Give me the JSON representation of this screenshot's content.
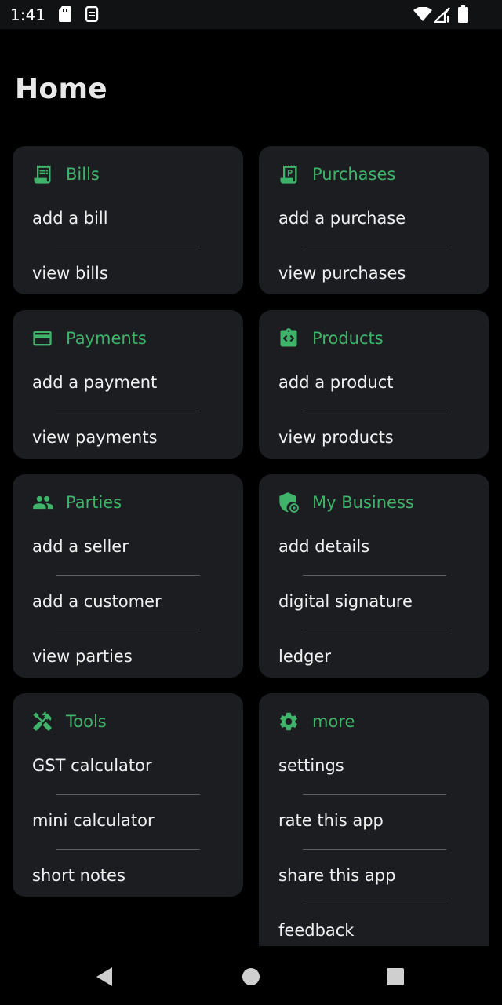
{
  "status_bar": {
    "time": "1:41"
  },
  "page": {
    "title": "Home"
  },
  "colors": {
    "accent": "#3fb36a",
    "card_bg": "#1c1d21",
    "background": "#000000",
    "text": "#f0f0f0"
  },
  "cards": {
    "bills": {
      "icon": "receipt-icon",
      "title": "Bills",
      "items": [
        "add a bill",
        "view bills"
      ]
    },
    "purchases": {
      "icon": "purchase-receipt-icon",
      "title": "Purchases",
      "items": [
        "add a purchase",
        "view purchases"
      ]
    },
    "payments": {
      "icon": "credit-card-icon",
      "title": "Payments",
      "items": [
        "add a payment",
        "view payments"
      ]
    },
    "products": {
      "icon": "product-box-icon",
      "title": "Products",
      "items": [
        "add a product",
        "view products"
      ]
    },
    "parties": {
      "icon": "people-icon",
      "title": "Parties",
      "items": [
        "add a seller",
        "add a customer",
        "view parties"
      ]
    },
    "business": {
      "icon": "shield-business-icon",
      "title": "My Business",
      "items": [
        "add details",
        "digital signature",
        "ledger"
      ]
    },
    "tools": {
      "icon": "tools-icon",
      "title": "Tools",
      "items": [
        "GST calculator",
        "mini calculator",
        "short notes"
      ]
    },
    "more": {
      "icon": "gear-icon",
      "title": "more",
      "items": [
        "settings",
        "rate this app",
        "share this app",
        "feedback"
      ]
    }
  }
}
